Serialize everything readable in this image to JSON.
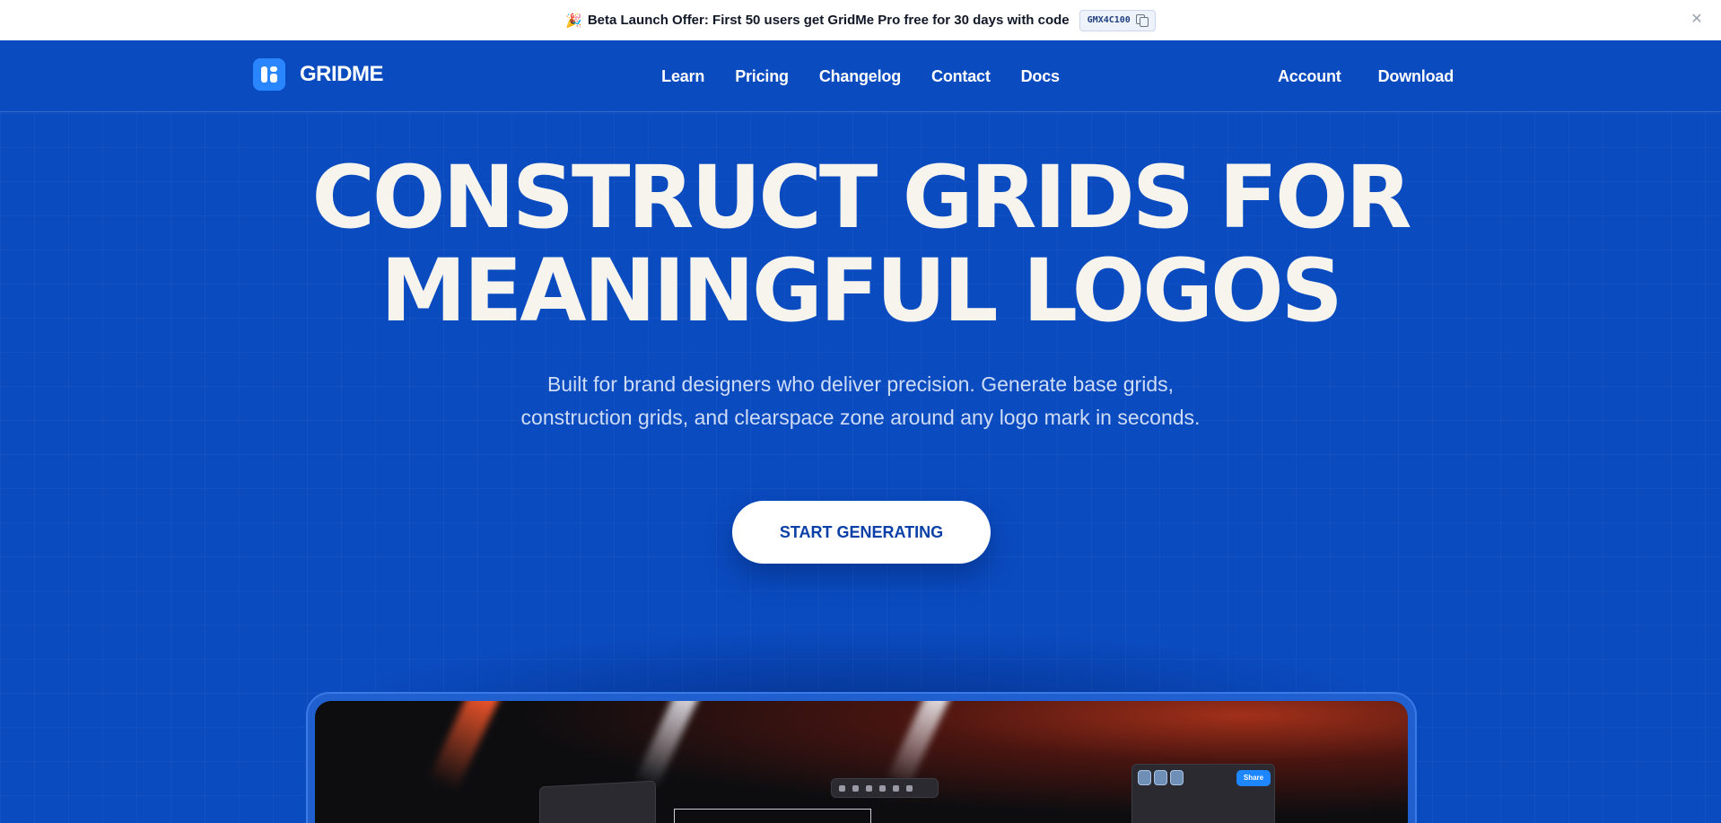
{
  "announcement": {
    "emoji": "🎉",
    "text": "Beta Launch Offer: First 50 users get GridMe Pro free for 30 days with code",
    "code": "GMX4C100",
    "close": "✕"
  },
  "nav": {
    "brand": "GRIDME",
    "links": [
      "Learn",
      "Pricing",
      "Changelog",
      "Contact",
      "Docs"
    ],
    "account": "Account",
    "download": "Download"
  },
  "hero": {
    "title_line1": "Construct Grids For",
    "title_line2": "Meaningful Logos",
    "subtitle_line1": "Built for brand designers who deliver precision. Generate base grids,",
    "subtitle_line2": "construction grids, and clearspace zone around any logo mark in seconds.",
    "cta": "START GENERATING"
  },
  "preview": {
    "share_label": "Share"
  },
  "colors": {
    "background": "#0a4bc0",
    "hero_text": "#f7f4ee",
    "cta_text": "#0a3fa8",
    "logo": "#2a86ff"
  }
}
